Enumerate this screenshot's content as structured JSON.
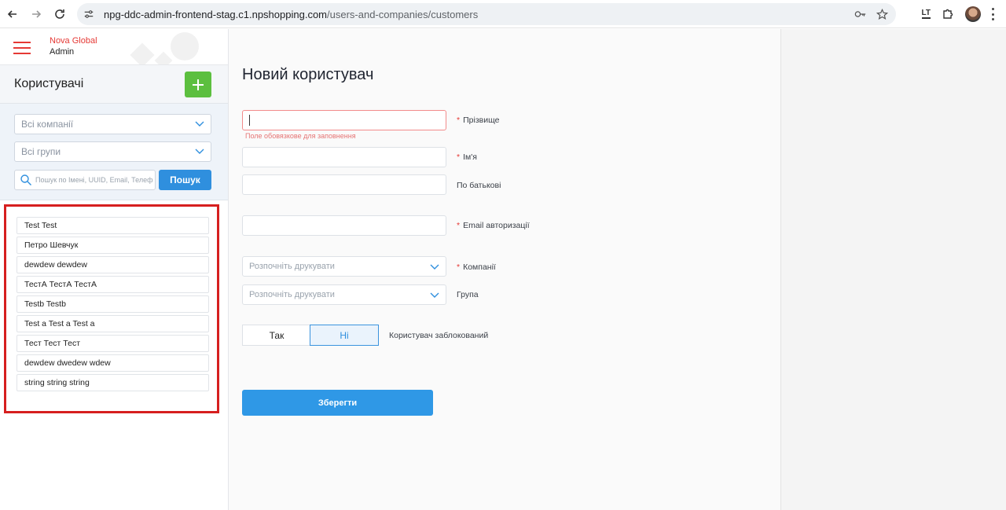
{
  "browser": {
    "url_host": "npg-ddc-admin-frontend-stag.c1.npshopping.com",
    "url_path": "/users-and-companies/customers",
    "extension_label": "LT"
  },
  "brand": {
    "name": "Nova Global",
    "role": "Admin"
  },
  "sidebar": {
    "title": "Користувачі",
    "companies_select": "Всі компанії",
    "groups_select": "Всі групи",
    "search_placeholder": "Пошук по Імені, UUID, Email, Телефону",
    "search_button": "Пошук",
    "users": [
      "Test Test",
      "Петро Шевчук",
      "dewdew dewdew",
      "ТестА ТестА ТестА",
      "Testb Testb",
      "Test a Test a Test a",
      "Тест Тест Тест",
      "dewdew dwedew wdew",
      "string string string"
    ]
  },
  "form": {
    "title": "Новий користувач",
    "required_mark": "*",
    "surname_label": "Прізвище",
    "surname_error": "Поле обовязкове для заповнення",
    "name_label": "Ім'я",
    "patronymic_label": "По батькові",
    "email_label": "Email авторизації",
    "companies_label": "Компанії",
    "companies_placeholder": "Розпочніть друкувати",
    "group_label": "Група",
    "group_placeholder": "Розпочніть друкувати",
    "blocked_yes": "Так",
    "blocked_no": "Ні",
    "blocked_selected": "Ні",
    "blocked_label": "Користувач заблокований",
    "save_button": "Зберегти"
  },
  "colors": {
    "accent_blue": "#2f8fde",
    "add_green": "#5cbf3f",
    "brand_red": "#e53935",
    "highlight_red": "#d61f1f"
  }
}
